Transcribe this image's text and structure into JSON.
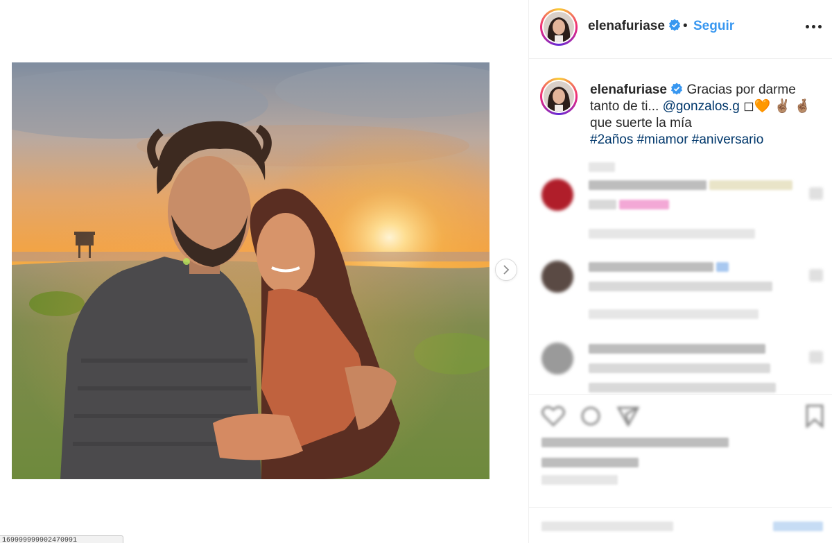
{
  "header": {
    "username": "elenafuriase",
    "separator": "•",
    "follow_label": "Seguir"
  },
  "caption": {
    "username": "elenafuriase",
    "text_before": "Gracias por darme tanto de ti... ",
    "mention": "@gonzalos.g",
    "emojis": " ◻🧡 ✌🏽 🤞🏽",
    "line2": "que suerte la mía",
    "hashtags": "#2años #miamor #aniversario"
  },
  "url_tooltip": "169999999902470991",
  "icons": {
    "verified": "verified-badge-icon",
    "more": "more-options-icon",
    "next": "chevron-right-icon",
    "like": "heart-icon",
    "comment": "comment-icon",
    "share": "share-icon",
    "save": "bookmark-icon"
  },
  "colors": {
    "accent": "#3897f0",
    "link": "#00376b",
    "text": "#262626",
    "border": "#efefef"
  }
}
